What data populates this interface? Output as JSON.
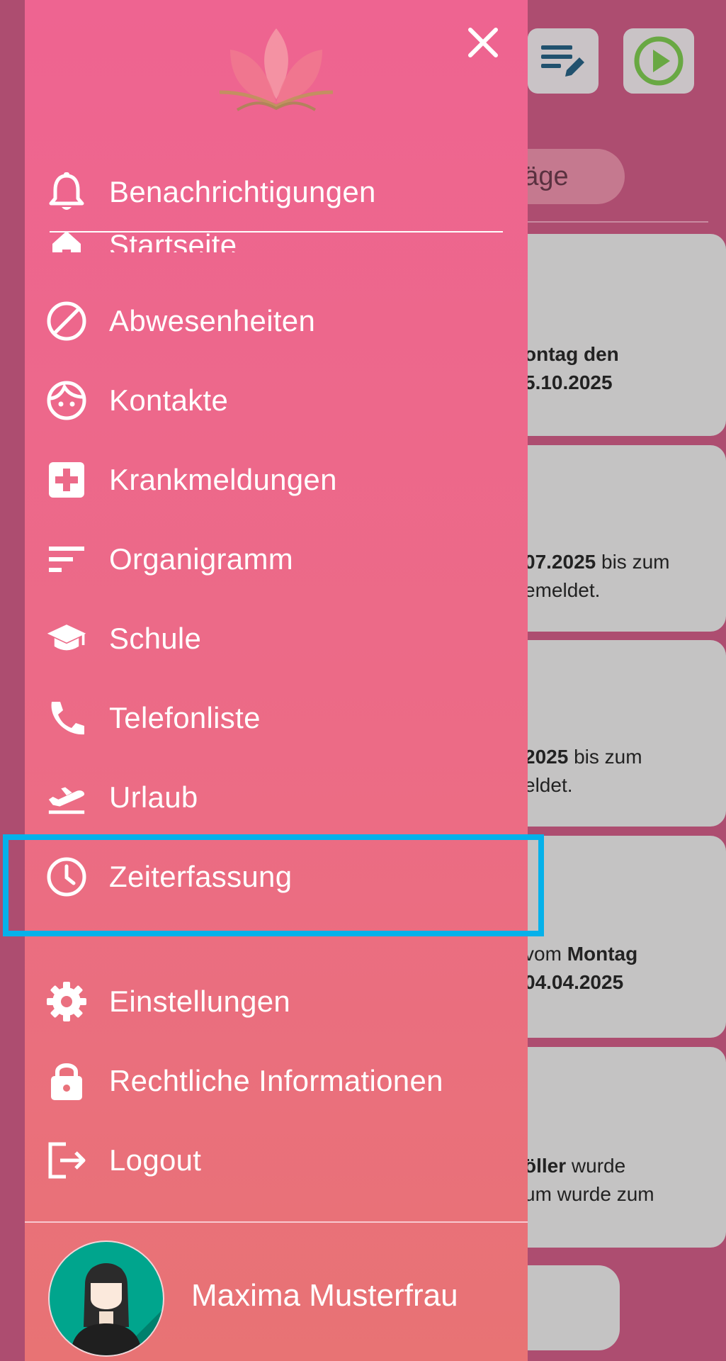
{
  "background": {
    "pill_label": "träge",
    "cards": [
      {
        "lines": [
          [
            {
              "t": "ontag den",
              "b": true
            }
          ],
          [
            {
              "t": "5.10.2025",
              "b": true
            }
          ]
        ]
      },
      {
        "lines": [
          [
            {
              "t": "07.2025",
              "b": true
            },
            {
              "t": " bis zum",
              "b": false
            }
          ],
          [
            {
              "t": "emeldet.",
              "b": false
            }
          ]
        ]
      },
      {
        "lines": [
          [
            {
              "t": "2025",
              "b": true
            },
            {
              "t": " bis zum",
              "b": false
            }
          ],
          [
            {
              "t": "eldet.",
              "b": false
            }
          ]
        ]
      },
      {
        "lines": [
          [
            {
              "t": "vom ",
              "b": false
            },
            {
              "t": "Montag",
              "b": true
            }
          ],
          [
            {
              "t": "04.04.2025",
              "b": true
            }
          ]
        ]
      },
      {
        "lines": [
          [
            {
              "t": "öller",
              "b": true
            },
            {
              "t": " wurde",
              "b": false
            }
          ],
          [
            {
              "t": "um wurde zum",
              "b": false
            }
          ]
        ]
      }
    ],
    "colors": {
      "edit_icon": "#21516e",
      "play_icon": "#69a843"
    }
  },
  "drawer": {
    "close_icon": "close-icon",
    "menu": [
      {
        "id": "notifications",
        "label": "Benachrichtigungen",
        "icon": "bell-icon"
      },
      {
        "id": "home",
        "label": "Startseite",
        "icon": "home-icon"
      },
      {
        "id": "absences",
        "label": "Abwesenheiten",
        "icon": "block-icon"
      },
      {
        "id": "contacts",
        "label": "Kontakte",
        "icon": "face-icon"
      },
      {
        "id": "sick-reports",
        "label": "Krankmeldungen",
        "icon": "medical-cross-icon"
      },
      {
        "id": "org-chart",
        "label": "Organigramm",
        "icon": "sort-lines-icon"
      },
      {
        "id": "school",
        "label": "Schule",
        "icon": "graduation-cap-icon"
      },
      {
        "id": "phone-list",
        "label": "Telefonliste",
        "icon": "phone-icon"
      },
      {
        "id": "vacation",
        "label": "Urlaub",
        "icon": "flight-takeoff-icon"
      },
      {
        "id": "time-tracking",
        "label": "Zeiterfassung",
        "icon": "clock-icon"
      },
      {
        "id": "settings",
        "label": "Einstellungen",
        "icon": "gear-icon"
      },
      {
        "id": "legal",
        "label": "Rechtliche Informationen",
        "icon": "lock-icon"
      },
      {
        "id": "logout",
        "label": "Logout",
        "icon": "logout-icon"
      }
    ],
    "user": {
      "name": "Maxima Musterfrau"
    },
    "colors": {
      "highlight": "#05b1ea",
      "avatar_bg": "#00a58d"
    }
  }
}
